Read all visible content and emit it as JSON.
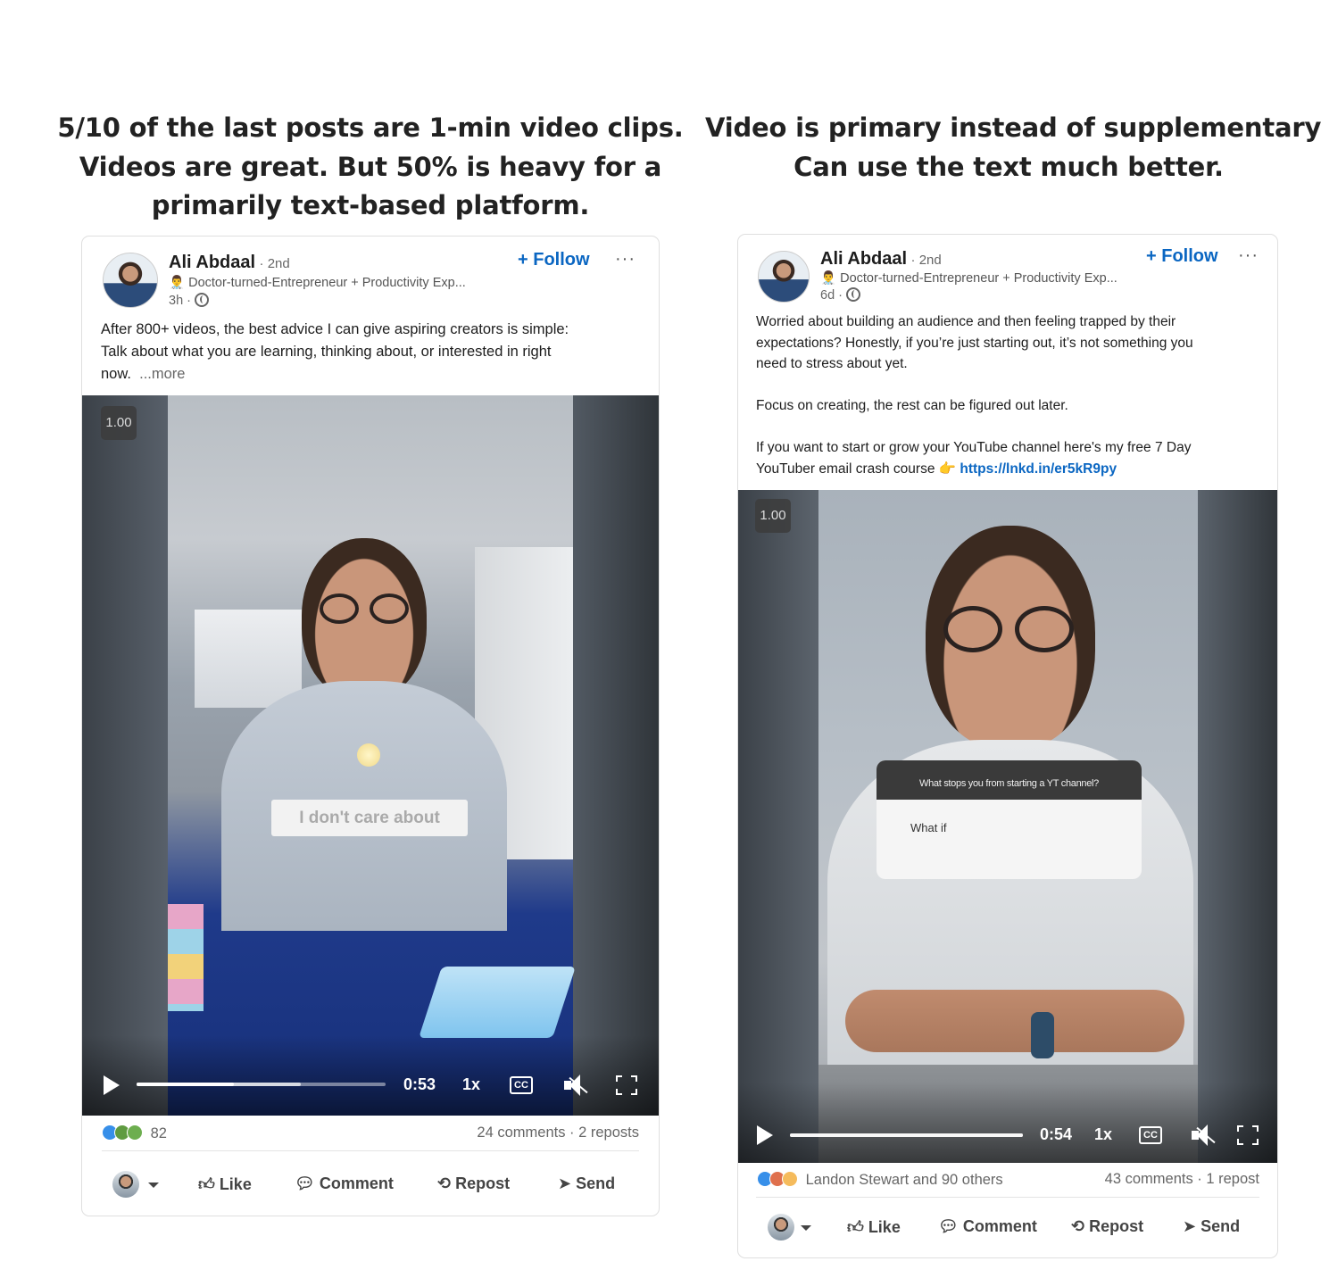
{
  "captions": {
    "left": [
      "5/10 of the last posts are 1-min video clips.",
      "Videos are great. But 50% is heavy for a",
      "primarily text-based platform."
    ],
    "right": [
      "Video is primary instead of supplementary.",
      "Can use the text much better."
    ]
  },
  "posts": [
    {
      "author": "Ali Abdaal",
      "degree": "2nd",
      "headline_emoji": "👨‍⚕️",
      "headline": "Doctor-turned-Entrepreneur + Productivity Exp...",
      "age": "3h",
      "follow_label": "+ Follow",
      "menu_icon": "···",
      "body": [
        "After 800+ videos, the best advice I can give aspiring creators is simple:",
        "Talk about what you are learning, thinking about, or interested in right",
        "now."
      ],
      "more_label": "...more",
      "video": {
        "speed_badge": "1.00",
        "overlay_text": "I don't care about",
        "time": "0:53",
        "speed": "1x",
        "cc": "CC",
        "progress": 0.39,
        "buffered": 0.66
      },
      "reactions_count": "82",
      "comments_reposts": "24 comments · 2 reposts",
      "actions": [
        "Like",
        "Comment",
        "Repost",
        "Send"
      ]
    },
    {
      "author": "Ali Abdaal",
      "degree": "2nd",
      "headline_emoji": "👨‍⚕️",
      "headline": "Doctor-turned-Entrepreneur + Productivity Exp...",
      "age": "6d",
      "follow_label": "+ Follow",
      "menu_icon": "···",
      "body": [
        "Worried about building an audience and then feeling trapped by their",
        "expectations? Honestly, if you’re just starting out, it’s not something you",
        "need to stress about yet."
      ],
      "body2": "Focus on creating, the rest can be figured out later.",
      "body3": [
        "If you want to start or grow your YouTube channel here's my free 7 Day",
        "YouTuber email crash course 👉"
      ],
      "link": "https://lnkd.in/er5kR9py",
      "video": {
        "speed_badge": "1.00",
        "question_title": "What stops you from starting a YT channel?",
        "question_answer": "What if",
        "time": "0:54",
        "speed": "1x",
        "cc": "CC",
        "progress": 1.0,
        "buffered": 1.0
      },
      "reactions_label": "Landon Stewart and 90 others",
      "comments_reposts": "43 comments · 1 repost",
      "actions": [
        "Like",
        "Comment",
        "Repost",
        "Send"
      ]
    }
  ]
}
